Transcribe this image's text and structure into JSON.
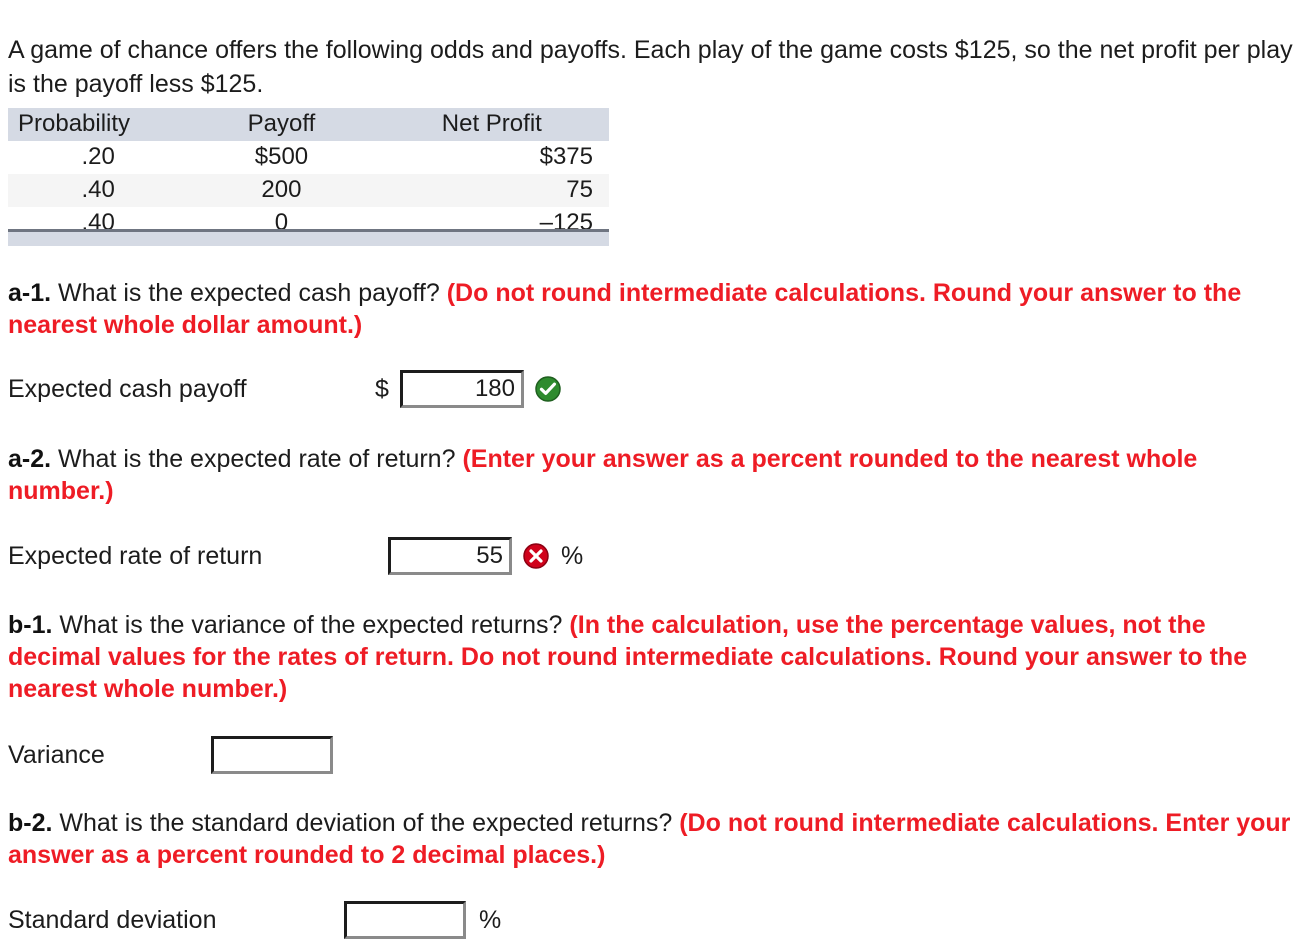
{
  "intro": {
    "paragraph": "A game of chance offers the following odds and payoffs. Each play of the game costs $125, so the net profit per play is the payoff less $125."
  },
  "table": {
    "headers": [
      "Probability",
      "Payoff",
      "Net Profit"
    ],
    "rows": [
      {
        "probability": ".20",
        "payoff": "$500",
        "net_profit": "$375"
      },
      {
        "probability": ".40",
        "payoff": "200",
        "net_profit": "75"
      },
      {
        "probability": ".40",
        "payoff": "0",
        "net_profit": "–125"
      }
    ]
  },
  "questions": {
    "a1": {
      "label": "a-1.",
      "text": "What is the expected cash payoff?",
      "hint": "(Do not round intermediate calculations. Round your answer to the nearest whole dollar amount.)"
    },
    "a2": {
      "label": "a-2.",
      "text": "What is the expected rate of return?",
      "hint": "(Enter your answer as a percent rounded to the nearest whole number.)"
    },
    "b1": {
      "label": "b-1.",
      "text": "What is the variance of the expected returns?",
      "hint": "(In the calculation, use the percentage values, not the decimal values for the rates of return. Do not round intermediate calculations. Round your answer to the nearest whole number.)"
    },
    "b2": {
      "label": "b-2.",
      "text": "What is the standard deviation of the expected returns?",
      "hint": "(Do not round intermediate calculations. Enter your answer as a percent rounded to 2 decimal places.)"
    }
  },
  "answers": {
    "expected_cash_payoff": {
      "label": "Expected cash payoff",
      "currency_symbol": "$",
      "value": "180",
      "placeholder": "",
      "status": "correct",
      "status_icon": "check-circle-icon"
    },
    "expected_rate_of_return": {
      "label": "Expected rate of return",
      "value": "55",
      "placeholder": "",
      "suffix": "%",
      "status": "incorrect",
      "status_icon": "x-circle-icon"
    },
    "variance": {
      "label": "Variance",
      "value": "",
      "placeholder": "",
      "status": "empty"
    },
    "standard_deviation": {
      "label": "Standard deviation",
      "value": "",
      "placeholder": "",
      "suffix": "%",
      "status": "empty"
    }
  },
  "colors": {
    "hint_red": "#ee1c25",
    "table_header_bg": "#d5dae4",
    "table_alt_row_bg": "#f5f5f5",
    "correct_green": "#2e8b2e",
    "incorrect_red": "#d0021b",
    "text": "#1c1c1c"
  }
}
